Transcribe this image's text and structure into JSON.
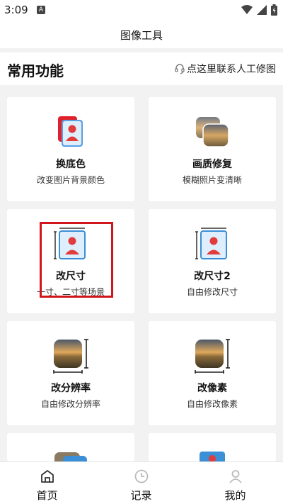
{
  "status_bar": {
    "time": "3:09",
    "notif_letter": "A"
  },
  "header": {
    "title": "图像工具"
  },
  "section": {
    "title": "常用功能",
    "contact_label": "点这里联系人工修图"
  },
  "tools": [
    {
      "title": "换底色",
      "subtitle": "改变图片背景颜色",
      "icon": "id-photo-bg-color-icon"
    },
    {
      "title": "画质修复",
      "subtitle": "模糊照片变清晰",
      "icon": "photo-restore-icon"
    },
    {
      "title": "改尺寸",
      "subtitle": "一寸、二寸等场景",
      "icon": "id-photo-resize-icon"
    },
    {
      "title": "改尺寸2",
      "subtitle": "自由修改尺寸",
      "icon": "id-photo-resize-icon"
    },
    {
      "title": "改分辨率",
      "subtitle": "自由修改分辨率",
      "icon": "landscape-resolution-icon"
    },
    {
      "title": "改像素",
      "subtitle": "自由修改像素",
      "icon": "landscape-pixel-icon"
    }
  ],
  "tab_bar": {
    "tabs": [
      {
        "label": "首页",
        "icon": "home-icon",
        "active": true
      },
      {
        "label": "记录",
        "icon": "clock-icon",
        "active": false
      },
      {
        "label": "我的",
        "icon": "person-icon",
        "active": false
      }
    ]
  },
  "colors": {
    "highlight": "#d0161b",
    "accent_red": "#e23b3b",
    "accent_blue": "#3a8fd6"
  }
}
